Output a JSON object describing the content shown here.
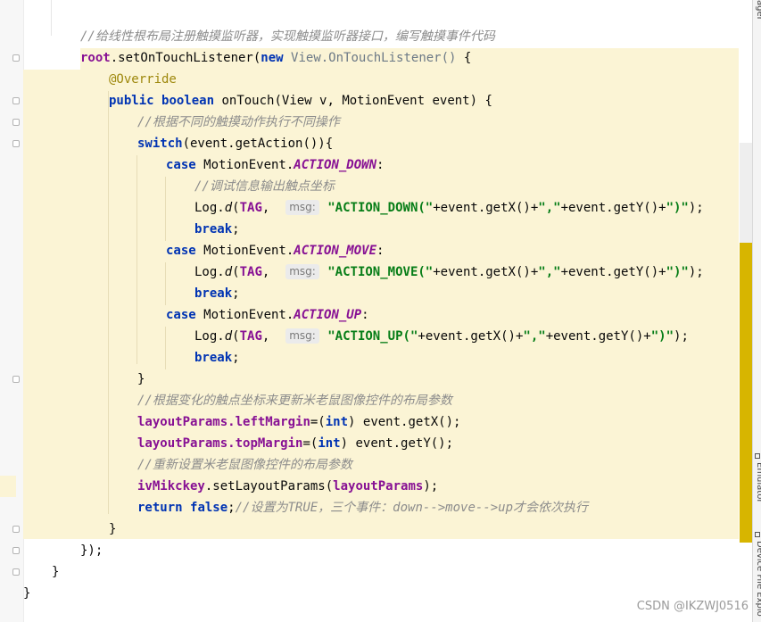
{
  "code": {
    "line_comment_top": "//给线性根布局注册触摸监听器，实现触摸监听器接口，编写触摸事件代码",
    "root": "root",
    "set_listener": ".setOnTouchListener(",
    "new_kw": "new",
    "listener_class": "View.OnTouchListener()",
    "brace_open": " {",
    "override": "@Override",
    "public_kw": "public",
    "boolean_kw": "boolean",
    "on_touch_sig": " onTouch(View v, MotionEvent event) {",
    "comment_dispatch": "//根据不同的触摸动作执行不同操作",
    "switch_kw": "switch",
    "switch_expr": "(event.getAction()){",
    "case_kw": "case",
    "motion_event": " MotionEvent.",
    "action_down": "ACTION_DOWN",
    "action_move": "ACTION_MOVE",
    "action_up": "ACTION_UP",
    "colon": ":",
    "comment_debug": "//调试信息输出触点坐标",
    "log_prefix": "Log.",
    "log_d": "d",
    "paren_open": "(",
    "tag": "TAG",
    "comma": ",",
    "msg_hint": "msg:",
    "str_down": "\"ACTION_DOWN(\"",
    "str_move": "\"ACTION_MOVE(\"",
    "str_up": "\"ACTION_UP(\"",
    "get_x": "+event.getX()+",
    "str_comma": "\",\"",
    "get_y": "+event.getY()+",
    "str_close": "\")\"",
    "end_call": ");",
    "break_kw": "break",
    "semicolon": ";",
    "close_brace": "}",
    "comment_update": "//根据变化的触点坐标来更新米老鼠图像控件的布局参数",
    "layout_params": "layoutParams",
    "left_margin": ".leftMargin",
    "top_margin": ".topMargin",
    "assign_int_open": "=(",
    "int_kw": "int",
    "get_x_call": ") event.getX();",
    "get_y_call": ") event.getY();",
    "comment_reset": "//重新设置米老鼠图像控件的布局参数",
    "iv_mikckey": "ivMikckey",
    "set_layout_params": ".setLayoutParams(",
    "close_paren_semi": ");",
    "return_kw": "return",
    "false_kw": "false",
    "comment_return": "//设置为TRUE，三个事件：down-->move-->up才会依次执行",
    "close_listener": "});"
  },
  "side_panel": {
    "label_top": "ager",
    "label_emulator": "Emulator",
    "label_device": "Device File Explo"
  },
  "watermark": "CSDN @IKZWJ0516",
  "colors": {
    "keyword": "#0033b3",
    "field": "#871094",
    "string": "#067d17",
    "comment": "#8c8c8c",
    "annotation": "#9e880d",
    "highlight_block": "#fbf4d5",
    "scroll_thumb": "#d7b500"
  }
}
